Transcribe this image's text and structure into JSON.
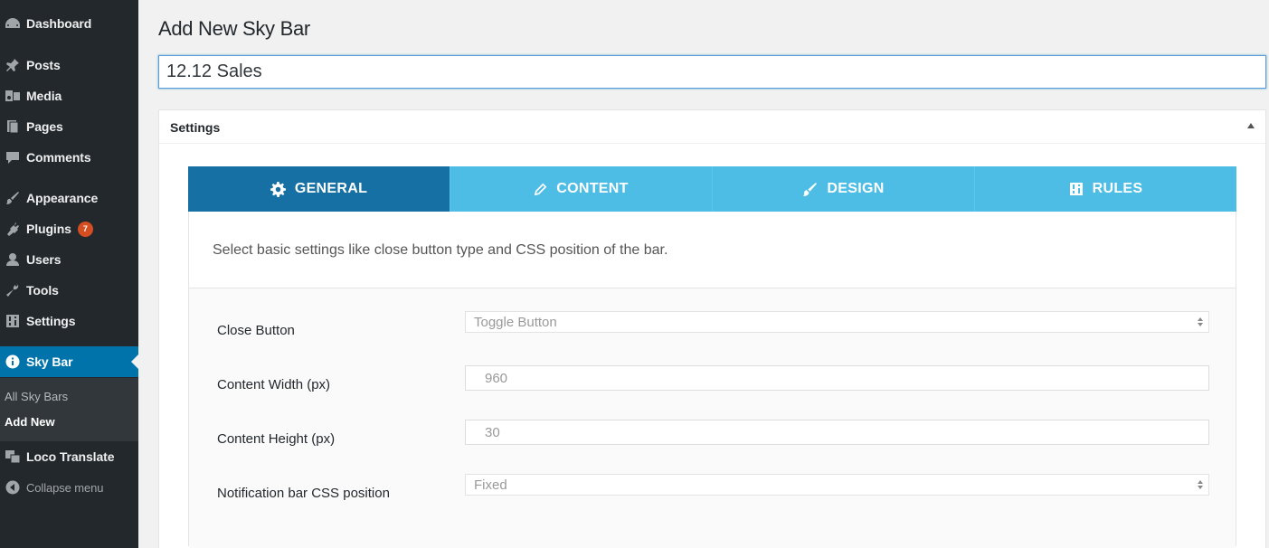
{
  "sidebar": {
    "items": [
      {
        "label": "Dashboard",
        "icon": "dashboard-icon"
      },
      {
        "label": "Posts",
        "icon": "pin-icon"
      },
      {
        "label": "Media",
        "icon": "media-icon"
      },
      {
        "label": "Pages",
        "icon": "pages-icon"
      },
      {
        "label": "Comments",
        "icon": "comment-icon"
      },
      {
        "label": "Appearance",
        "icon": "brush-icon"
      },
      {
        "label": "Plugins",
        "icon": "plug-icon",
        "badge": "7"
      },
      {
        "label": "Users",
        "icon": "user-icon"
      },
      {
        "label": "Tools",
        "icon": "wrench-icon"
      },
      {
        "label": "Settings",
        "icon": "settings-icon"
      },
      {
        "label": "Sky Bar",
        "icon": "info-icon",
        "active": true
      },
      {
        "label": "Loco Translate",
        "icon": "translate-icon"
      },
      {
        "label": "Collapse menu",
        "icon": "collapse-icon"
      }
    ],
    "submenu": [
      {
        "label": "All Sky Bars"
      },
      {
        "label": "Add New",
        "current": true
      }
    ]
  },
  "page": {
    "title": "Add New Sky Bar",
    "title_input_value": "12.12 Sales"
  },
  "settings": {
    "title": "Settings",
    "tabs": [
      {
        "label": "GENERAL",
        "icon": "gear-icon",
        "active": true
      },
      {
        "label": "CONTENT",
        "icon": "pencil-icon"
      },
      {
        "label": "DESIGN",
        "icon": "hammer-icon"
      },
      {
        "label": "RULES",
        "icon": "rules-icon"
      }
    ],
    "description": "Select basic settings like close button type and CSS position of the bar.",
    "fields": [
      {
        "label": "Close Button",
        "value": "Toggle Button",
        "type": "select"
      },
      {
        "label": "Content Width (px)",
        "value": "960",
        "type": "text"
      },
      {
        "label": "Content Height (px)",
        "value": "30",
        "type": "text"
      },
      {
        "label": "Notification bar CSS position",
        "value": "Fixed",
        "type": "select"
      }
    ]
  },
  "colors": {
    "sidebar_bg": "#23282d",
    "accent": "#0073aa",
    "tab_active": "#1670a3",
    "tab_inactive": "#4dbde6",
    "badge": "#d54e21"
  }
}
